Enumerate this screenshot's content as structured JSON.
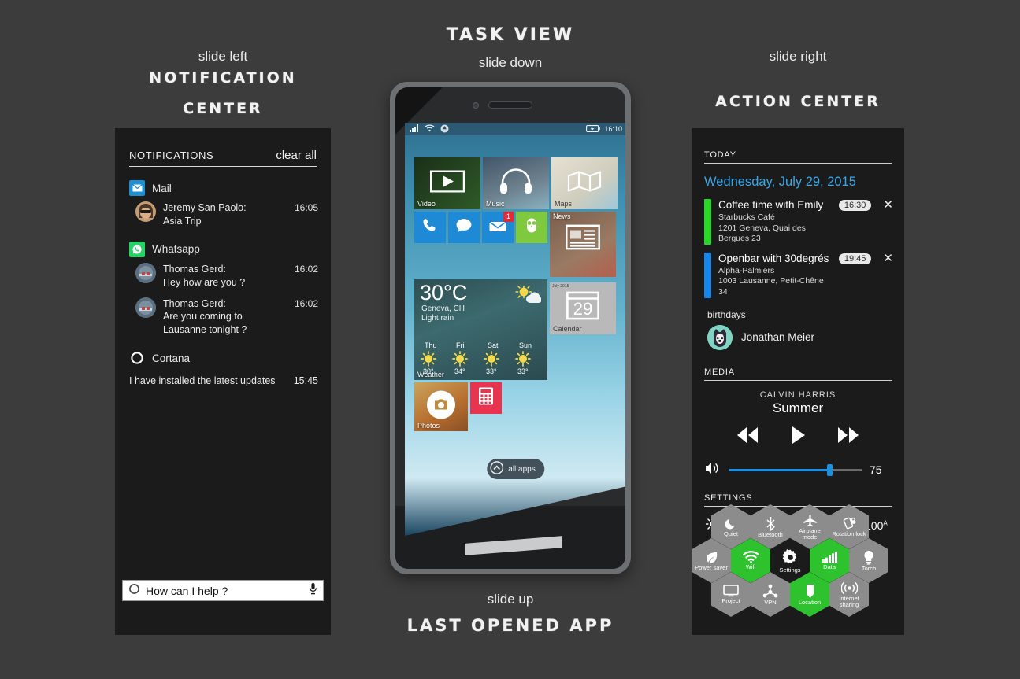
{
  "annotations": {
    "left_slide": "slide left",
    "left_title_l1": "NOTIFICATION",
    "left_title_l2": "CENTER",
    "center_title": "TASK VIEW",
    "center_slide": "slide down",
    "right_slide": "slide right",
    "right_title": "ACTION CENTER",
    "bottom_slide": "slide up",
    "bottom_title": "LAST OPENED APP"
  },
  "notification_center": {
    "header_title": "NOTIFICATIONS",
    "clear_all": "clear all",
    "groups": [
      {
        "app": "Mail",
        "icon": "mail-icon",
        "icon_color": "#1c8fd1",
        "items": [
          {
            "sender": "Jeremy San Paolo:",
            "message": "Asia Trip",
            "time": "16:05",
            "avatar": "avatar-jeremy"
          }
        ]
      },
      {
        "app": "Whatsapp",
        "icon": "whatsapp-icon",
        "icon_color": "#25d366",
        "items": [
          {
            "sender": "Thomas Gerd:",
            "message": "Hey how are you ?",
            "time": "16:02",
            "avatar": "avatar-thomas"
          },
          {
            "sender": "Thomas Gerd:",
            "message": "Are you coming to Lausanne tonight ?",
            "time": "16:02",
            "avatar": "avatar-thomas"
          }
        ]
      }
    ],
    "cortana_group": {
      "app": "Cortana",
      "icon": "cortana-ring-icon",
      "message": "I have installed the latest updates",
      "time": "15:45"
    },
    "cortana_search": {
      "placeholder": "How can I help ?",
      "value": "How can I help ?",
      "mic_icon": "microphone-icon",
      "ring_icon": "cortana-ring-icon"
    }
  },
  "action_center": {
    "today_header": "TODAY",
    "date": "Wednesday, July 29, 2015",
    "date_color": "#3aa8e8",
    "events": [
      {
        "title": "Coffee time with Emily",
        "place": "Starbucks Café",
        "address": "1201 Geneva, Quai des Bergues 23",
        "time": "16:30",
        "bar_color": "#28d828",
        "dismiss_icon": "close-icon"
      },
      {
        "title": "Openbar with 30degrés",
        "place": "Alpha-Palmiers",
        "address": "1003 Lausanne, Petit-Chêne 34",
        "time": "19:45",
        "bar_color": "#1886e8",
        "dismiss_icon": "close-icon"
      }
    ],
    "birthdays_label": "birthdays",
    "birthday_name": "Jonathan Meier",
    "media": {
      "header": "MEDIA",
      "artist": "CALVIN HARRIS",
      "track": "Summer",
      "prev_icon": "rewind-icon",
      "play_icon": "play-icon",
      "next_icon": "fast-forward-icon",
      "volume_icon": "speaker-icon",
      "volume_value": "75",
      "volume_percent": 75,
      "volume_color": "#1e90e0"
    },
    "settings": {
      "header": "SETTINGS",
      "brightness_icon": "brightness-icon",
      "brightness_value": "100",
      "brightness_unit": "A",
      "brightness_percent": 100,
      "brightness_color": "#e8b610"
    },
    "toggles": [
      {
        "label": "Quiet",
        "icon": "moon-icon",
        "on": false,
        "col": 1,
        "row": 0
      },
      {
        "label": "Bluetooth",
        "icon": "bluetooth-icon",
        "on": false,
        "col": 2,
        "row": 0
      },
      {
        "label": "Airplane mode",
        "icon": "airplane-icon",
        "on": false,
        "col": 3,
        "row": 0
      },
      {
        "label": "Rotation lock",
        "icon": "rotation-lock-icon",
        "on": false,
        "col": 4,
        "row": 0
      },
      {
        "label": "Power saver",
        "icon": "leaf-icon",
        "on": false,
        "col": 0,
        "row": 1
      },
      {
        "label": "Wifi",
        "icon": "wifi-icon",
        "on": true,
        "col": 1,
        "row": 1
      },
      {
        "label": "Settings",
        "icon": "gear-icon",
        "on": null,
        "col": 2,
        "row": 1
      },
      {
        "label": "Data",
        "icon": "signal-bars-icon",
        "on": true,
        "col": 3,
        "row": 1
      },
      {
        "label": "Torch",
        "icon": "bulb-icon",
        "on": false,
        "col": 4,
        "row": 1
      },
      {
        "label": "Project",
        "icon": "monitor-icon",
        "on": false,
        "col": 1,
        "row": 2
      },
      {
        "label": "VPN",
        "icon": "vpn-icon",
        "on": false,
        "col": 2,
        "row": 2
      },
      {
        "label": "Location",
        "icon": "location-pin-icon",
        "on": true,
        "col": 3,
        "row": 2
      },
      {
        "label": "Internet sharing",
        "icon": "internet-sharing-icon",
        "on": false,
        "col": 4,
        "row": 2
      }
    ],
    "toggle_on_color": "#2fc22f",
    "toggle_off_color": "#8c8c8c"
  },
  "phone": {
    "status_bar": {
      "signal_icon": "signal-bars-icon",
      "wifi_icon": "wifi-icon",
      "sync_icon": "sync-icon",
      "battery_icon": "battery-charging-icon",
      "clock": "16:10"
    },
    "tiles": [
      {
        "name": "Video",
        "label": "Video",
        "icon": "video-play-icon",
        "color": "#1d3a1d"
      },
      {
        "name": "Music",
        "label": "Music",
        "icon": "headphones-icon",
        "color": "#35506b"
      },
      {
        "name": "Maps",
        "label": "Maps",
        "icon": "map-fold-icon",
        "color": "#d8d4c8"
      },
      {
        "name": "Phone",
        "label": "",
        "icon": "phone-icon",
        "color": "#1e8ad6"
      },
      {
        "name": "Messages",
        "label": "",
        "icon": "chat-bubble-icon",
        "color": "#1e8ad6"
      },
      {
        "name": "Mail",
        "label": "",
        "icon": "mail-icon",
        "color": "#1e8ad6",
        "badge": "1"
      },
      {
        "name": "Duolingo",
        "label": "",
        "icon": "owl-icon",
        "color": "#7fc93f"
      },
      {
        "name": "News",
        "label": "News",
        "icon": "news-icon",
        "color": "#6d5548"
      },
      {
        "name": "Calendar",
        "label": "Calendar",
        "icon": "calendar-icon",
        "color": "#b9b9b9",
        "day": "29",
        "month": "July 2015"
      },
      {
        "name": "Photos",
        "label": "Photos",
        "icon": "camera-icon",
        "color": "#c08a3e"
      },
      {
        "name": "Calculator",
        "label": "",
        "icon": "calculator-icon",
        "color": "#e8344e"
      }
    ],
    "weather": {
      "temperature": "30°C",
      "location": "Geneva, CH",
      "condition": "Light rain",
      "label": "Weather",
      "forecast": [
        {
          "day": "Thu",
          "icon": "sun-icon",
          "high": "30°"
        },
        {
          "day": "Fri",
          "icon": "sun-icon",
          "high": "34°"
        },
        {
          "day": "Sat",
          "icon": "sun-icon",
          "high": "33°"
        },
        {
          "day": "Sun",
          "icon": "sun-icon",
          "high": "33°"
        }
      ]
    },
    "all_apps": {
      "label": "all apps",
      "icon": "chevron-up-circle-icon"
    }
  }
}
